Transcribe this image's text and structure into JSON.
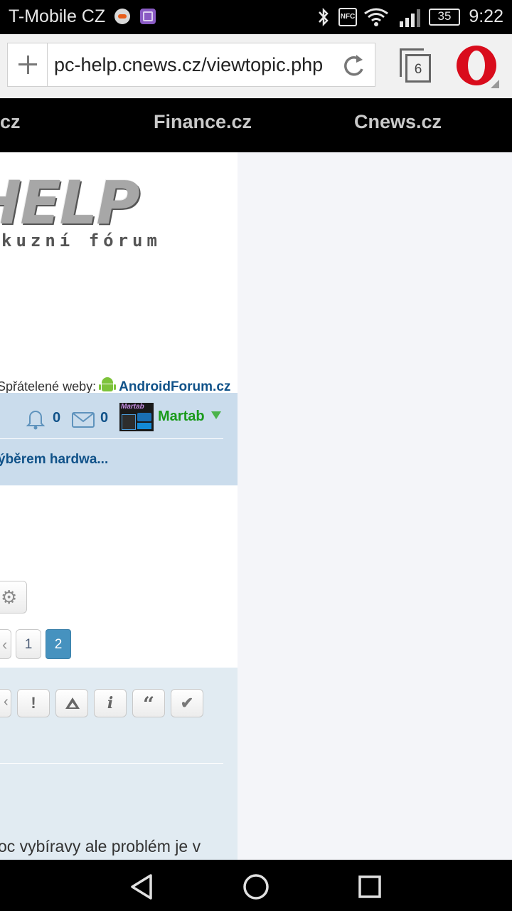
{
  "status_bar": {
    "carrier": "T-Mobile CZ",
    "battery": "35",
    "time": "9:22",
    "icons": [
      "notification-icon",
      "gallery-icon",
      "bluetooth-icon",
      "nfc-icon",
      "wifi-icon",
      "signal-icon",
      "battery-icon"
    ]
  },
  "browser": {
    "url": "pc-help.cnews.cz/viewtopic.php",
    "tab_count": "6",
    "icons": [
      "new-tab-plus-icon",
      "reload-icon",
      "tabs-icon",
      "opera-menu-icon"
    ]
  },
  "site_nav": {
    "items": [
      "cz",
      "Finance.cz",
      "Cnews.cz"
    ]
  },
  "logo": {
    "text": "HELP",
    "subtitle": "kuzní fórum"
  },
  "friends": {
    "label": "Spřátelené weby:",
    "link": "AndroidForum.cz"
  },
  "user_bar": {
    "notifications": "0",
    "messages": "0",
    "username": "Martab",
    "avatar_text": "Martab"
  },
  "breadcrumb": {
    "topic": "ýběrem hardwa..."
  },
  "pagination": {
    "pages": [
      "1",
      "2"
    ],
    "current": "2"
  },
  "post": {
    "text": "oc vybíravy ale problém je v"
  },
  "colors": {
    "link": "#105289",
    "username": "#1a9a1a",
    "page_active": "#4692bf",
    "blue_band": "#cadcec",
    "post_bg": "#e1ebf2"
  }
}
